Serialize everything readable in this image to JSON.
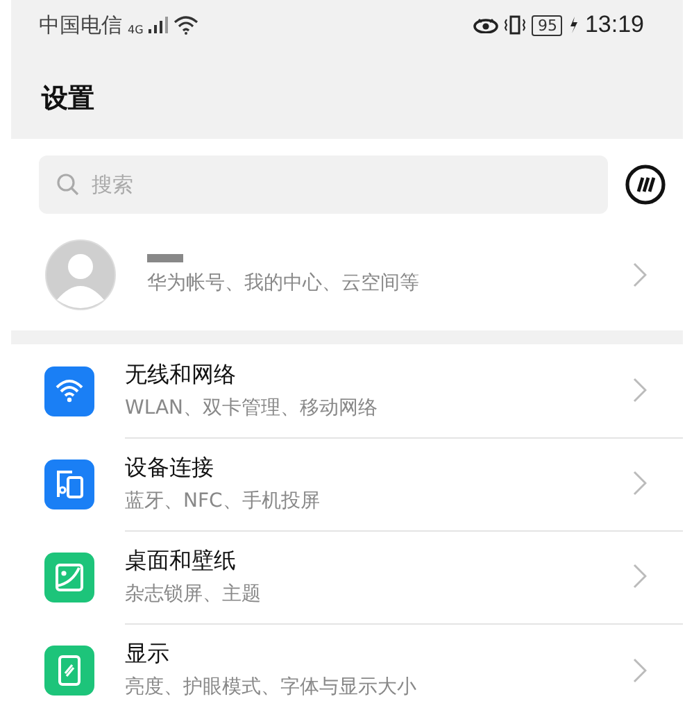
{
  "status_bar": {
    "carrier": "中国电信",
    "network": "4G",
    "battery": "95",
    "time": "13:19"
  },
  "title": "设置",
  "search": {
    "placeholder": "搜索"
  },
  "account": {
    "subtitle": "华为帐号、我的中心、云空间等"
  },
  "items": [
    {
      "color": "#1a7ff5",
      "title": "无线和网络",
      "subtitle": "WLAN、双卡管理、移动网络"
    },
    {
      "color": "#1a7ff5",
      "title": "设备连接",
      "subtitle": "蓝牙、NFC、手机投屏"
    },
    {
      "color": "#1dc47a",
      "title": "桌面和壁纸",
      "subtitle": "杂志锁屏、主题"
    },
    {
      "color": "#1dc47a",
      "title": "显示",
      "subtitle": "亮度、护眼模式、字体与显示大小"
    }
  ]
}
